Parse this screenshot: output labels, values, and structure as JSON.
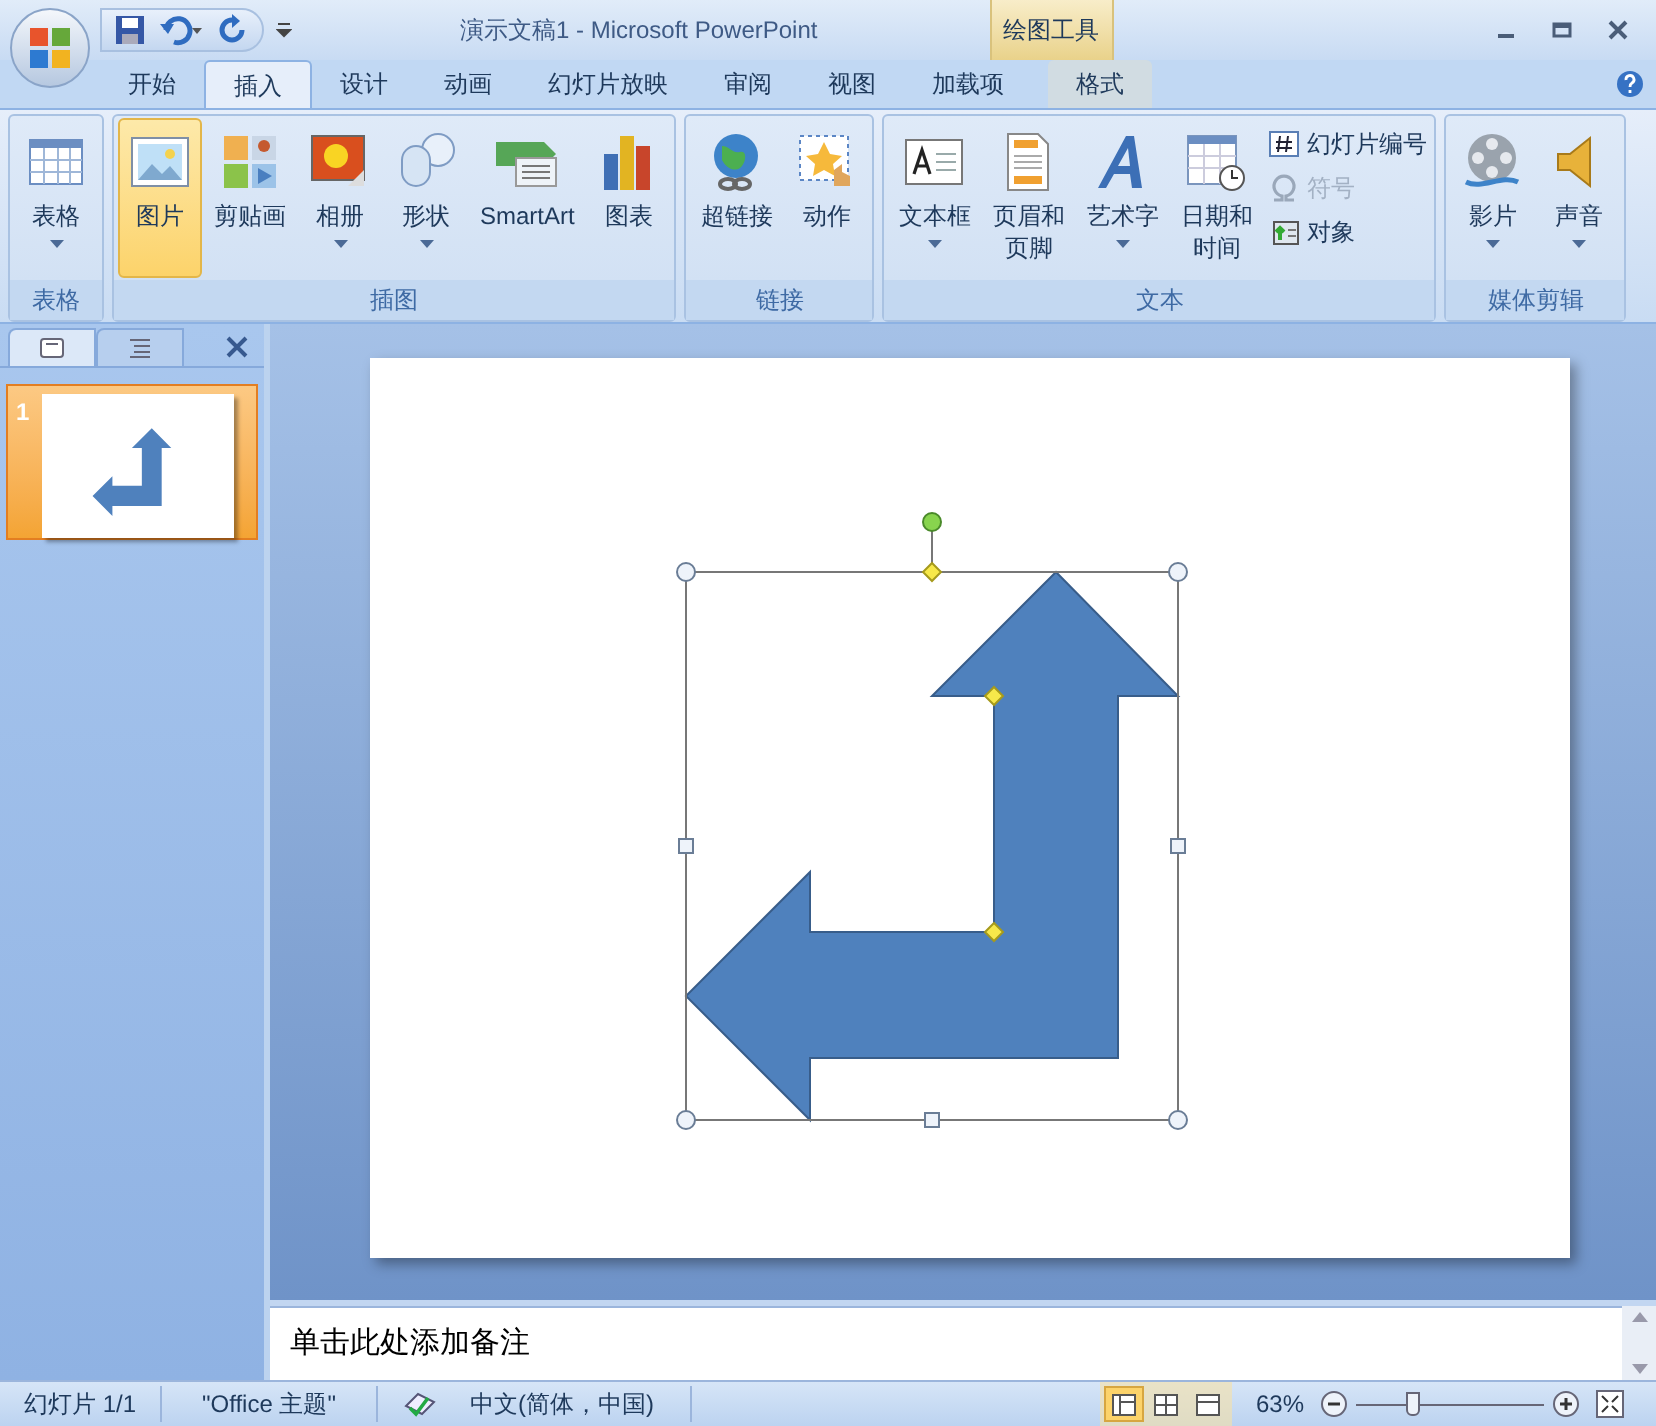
{
  "window": {
    "title": "演示文稿1 - Microsoft PowerPoint",
    "context_tab": "绘图工具"
  },
  "tabs": [
    {
      "label": "开始",
      "selected": false
    },
    {
      "label": "插入",
      "selected": true
    },
    {
      "label": "设计",
      "selected": false
    },
    {
      "label": "动画",
      "selected": false
    },
    {
      "label": "幻灯片放映",
      "selected": false
    },
    {
      "label": "审阅",
      "selected": false
    },
    {
      "label": "视图",
      "selected": false
    },
    {
      "label": "加载项",
      "selected": false
    },
    {
      "label": "格式",
      "selected": false,
      "kind": "context"
    }
  ],
  "ribbon": [
    {
      "label": "表格",
      "buttons": [
        {
          "kind": "large",
          "label": "表格",
          "dropdown": true,
          "selected": false
        }
      ]
    },
    {
      "label": "插图",
      "buttons": [
        {
          "kind": "large",
          "label": "图片",
          "dropdown": false,
          "selected": true
        },
        {
          "kind": "large",
          "label": "剪贴画",
          "dropdown": false,
          "selected": false
        },
        {
          "kind": "large",
          "label": "相册",
          "dropdown": true,
          "selected": false
        },
        {
          "kind": "large",
          "label": "形状",
          "dropdown": true,
          "selected": false
        },
        {
          "kind": "large",
          "label": "SmartArt",
          "dropdown": false,
          "selected": false
        },
        {
          "kind": "large",
          "label": "图表",
          "dropdown": false,
          "selected": false
        }
      ]
    },
    {
      "label": "链接",
      "buttons": [
        {
          "kind": "large",
          "label": "超链接",
          "dropdown": false,
          "selected": false
        },
        {
          "kind": "large",
          "label": "动作",
          "dropdown": false,
          "selected": false
        }
      ]
    },
    {
      "label": "文本",
      "buttons": [
        {
          "kind": "large",
          "label": "文本框",
          "dropdown": true,
          "selected": false
        },
        {
          "kind": "large",
          "lines": [
            "页眉和",
            "页脚"
          ],
          "dropdown": false,
          "selected": false
        },
        {
          "kind": "large",
          "label": "艺术字",
          "dropdown": true,
          "selected": false
        },
        {
          "kind": "large",
          "lines": [
            "日期和",
            "时间"
          ],
          "dropdown": false,
          "selected": false
        },
        {
          "kind": "small",
          "label": "幻灯片编号",
          "disabled": false
        },
        {
          "kind": "small",
          "label": "符号",
          "disabled": true
        },
        {
          "kind": "small",
          "label": "对象",
          "disabled": false
        }
      ]
    },
    {
      "label": "媒体剪辑",
      "buttons": [
        {
          "kind": "large",
          "label": "影片",
          "dropdown": true,
          "selected": false
        },
        {
          "kind": "large",
          "label": "声音",
          "dropdown": true,
          "selected": false
        }
      ]
    }
  ],
  "pane_tabs": [
    {
      "selected": true
    },
    {
      "selected": false
    }
  ],
  "slides": [
    {
      "number": "1",
      "selected": true
    }
  ],
  "shape": {
    "kind": "bent-arrow",
    "selected": true
  },
  "notes": {
    "placeholder": "单击此处添加备注"
  },
  "status_bar": {
    "slide": "幻灯片 1/1",
    "theme": "\"Office 主题\"",
    "language": "中文(简体，中国)",
    "views": [
      {
        "selected": true
      },
      {
        "selected": false
      },
      {
        "selected": false
      }
    ],
    "zoom": "63%",
    "zoom_slider": {
      "level": 0.3
    }
  }
}
